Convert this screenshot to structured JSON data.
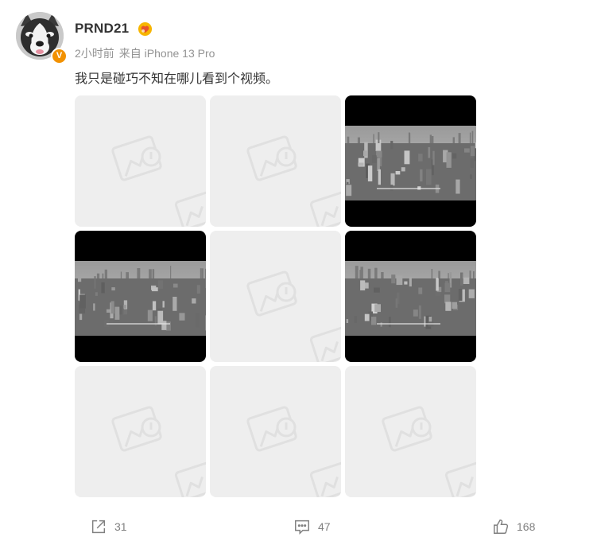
{
  "post": {
    "author": {
      "name": "PRND21",
      "avatar_icon": "husky-dog-avatar",
      "verified_badge_icon": "v-verified-badge-icon",
      "verified_label": "V",
      "level_badge_icon": "gold-fan-badge-icon"
    },
    "time": "2小时前",
    "source": "来自 iPhone 13 Pro",
    "text": "我只是碰巧不知在哪儿看到个视频。",
    "images": [
      {
        "kind": "placeholder",
        "icon": "image-placeholder-icon"
      },
      {
        "kind": "placeholder",
        "icon": "image-placeholder-icon"
      },
      {
        "kind": "video-frame",
        "scene": "grayscale city aerial"
      },
      {
        "kind": "video-frame",
        "scene": "grayscale city aerial"
      },
      {
        "kind": "placeholder",
        "icon": "image-placeholder-icon"
      },
      {
        "kind": "video-frame",
        "scene": "grayscale city aerial"
      },
      {
        "kind": "placeholder",
        "icon": "image-placeholder-icon"
      },
      {
        "kind": "placeholder",
        "icon": "image-placeholder-icon"
      },
      {
        "kind": "placeholder",
        "icon": "image-placeholder-icon"
      }
    ]
  },
  "actions": {
    "repost": {
      "icon": "share-icon",
      "count": "31"
    },
    "comment": {
      "icon": "comment-icon",
      "count": "47"
    },
    "like": {
      "icon": "thumbs-up-icon",
      "count": "168"
    }
  },
  "colors": {
    "text_primary": "#333333",
    "text_meta": "#939393",
    "placeholder_bg": "#eeeeee",
    "verified_orange": "#f29100",
    "action_gray": "#808080"
  }
}
